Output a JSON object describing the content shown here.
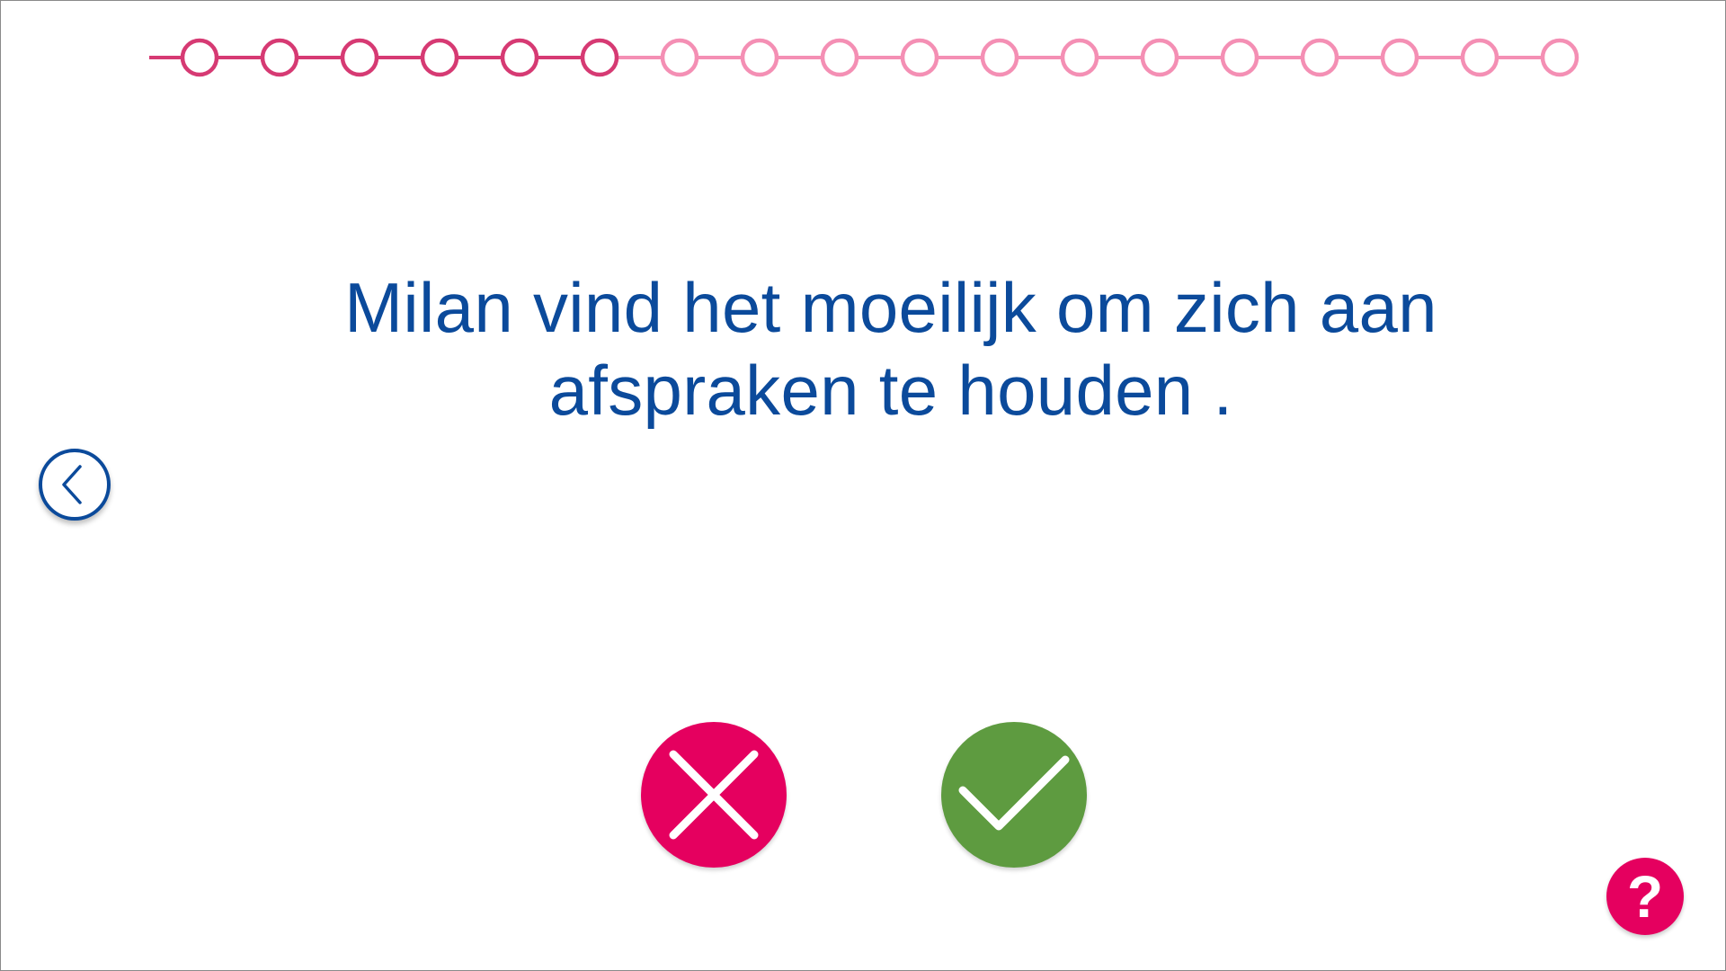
{
  "progress": {
    "total_steps": 18,
    "completed_steps": 6,
    "completed_color": "#d63a73",
    "remaining_color": "#f48fb4"
  },
  "question": {
    "line1": "Milan vind het moeilijk om zich aan",
    "line2": "afspraken te houden ."
  },
  "buttons": {
    "back": {
      "icon": "chevron-left-icon",
      "color": "#0b4a9b"
    },
    "no": {
      "icon": "close-icon",
      "color": "#e5005f"
    },
    "yes": {
      "icon": "checkmark-icon",
      "color": "#5e9b40"
    },
    "help": {
      "label": "?",
      "icon": "question-mark-icon",
      "color": "#e5005f"
    }
  }
}
